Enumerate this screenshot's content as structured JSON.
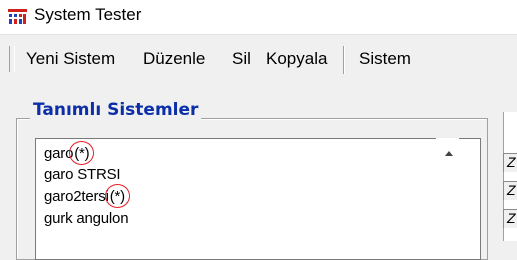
{
  "window": {
    "title": "System Tester",
    "icon": "app-grid-icon"
  },
  "toolbar": {
    "items": [
      "Yeni Sistem",
      "Düzenle",
      "Sil",
      "Kopyala",
      "Sistem"
    ]
  },
  "group": {
    "title": "Tanımlı Sistemler",
    "list": [
      {
        "name": "garo",
        "mark": "(*)"
      },
      {
        "name": "garo STRSI",
        "mark": ""
      },
      {
        "name": "garo2tersi",
        "mark": "(*)"
      },
      {
        "name": "gurk angulon",
        "mark": ""
      }
    ]
  },
  "right_table": {
    "cells": [
      "Z",
      "Z",
      "Z"
    ]
  },
  "colors": {
    "group_title": "#0c2fa8",
    "annotation": "#e0202a"
  }
}
